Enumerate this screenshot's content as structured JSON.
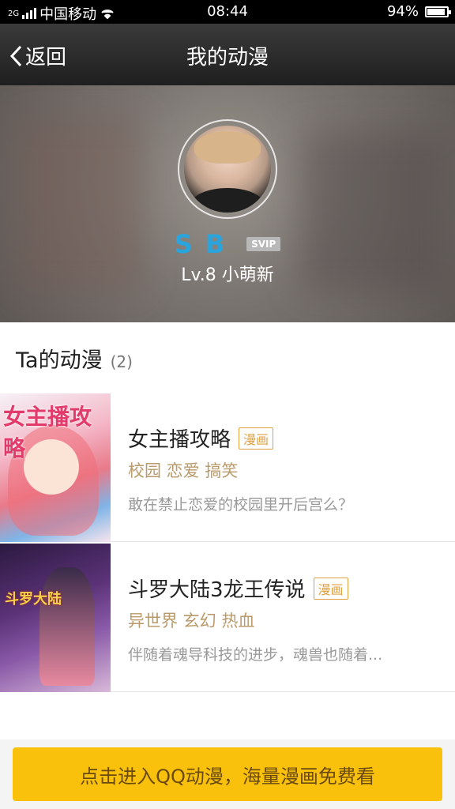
{
  "status_bar": {
    "network": "2G",
    "carrier": "中国移动",
    "time": "08:44",
    "battery": "94%",
    "battery_level": 0.94
  },
  "nav": {
    "back_label": "返回",
    "title": "我的动漫"
  },
  "profile": {
    "username": "SB",
    "vip_badge": "SVIP",
    "level": "Lv.8 小萌新"
  },
  "section": {
    "title": "Ta的动漫",
    "count": "(2)"
  },
  "comics": [
    {
      "name": "女主播攻略",
      "badge": "漫画",
      "tags": "校园 恋爱 搞笑",
      "description": "敢在禁止恋爱的校园里开后宫么？",
      "cover_text": "女主播攻略"
    },
    {
      "name": "斗罗大陆3龙王传说",
      "badge": "漫画",
      "tags": "异世界 玄幻 热血",
      "description": "伴随着魂导科技的进步，魂兽也随着...",
      "cover_text": "斗罗大陆"
    }
  ],
  "cta_label": "点击进入QQ动漫，海量漫画免费看",
  "colors": {
    "accent": "#f9c10c",
    "username": "#2aa4dc",
    "tag": "#b99a6a",
    "badge": "#e0a040"
  }
}
